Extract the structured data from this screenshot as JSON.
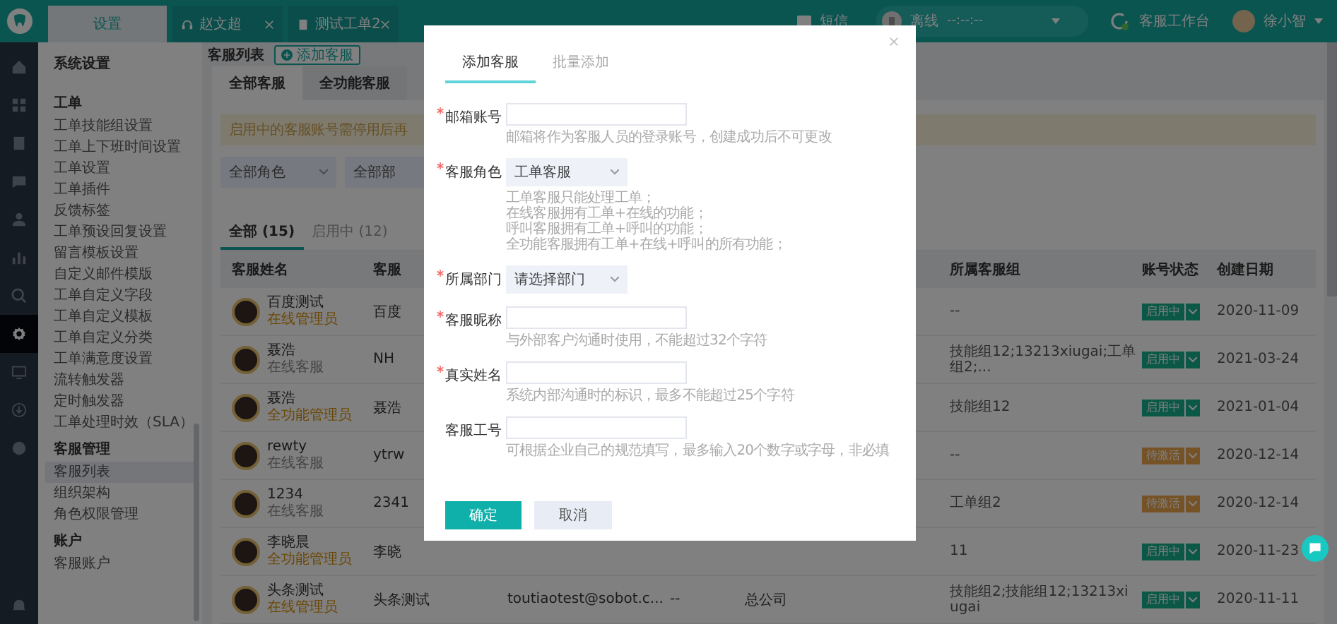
{
  "topbar": {
    "tabs": [
      {
        "label": "设置",
        "selected": true
      },
      {
        "label": "赵文超",
        "selected": false
      },
      {
        "label": "测试工单2",
        "selected": false
      }
    ],
    "sms": "短信",
    "presence": {
      "label": "离线",
      "time": "--:--:--"
    },
    "workbench": "客服工作台",
    "user": "徐小智"
  },
  "rail": [
    {
      "selected": false
    },
    {
      "selected": false
    },
    {
      "selected": false
    },
    {
      "selected": false
    },
    {
      "selected": false
    },
    {
      "selected": false
    },
    {
      "selected": false
    },
    {
      "selected": true
    },
    {
      "selected": false
    },
    {
      "selected": false
    },
    {
      "selected": false
    }
  ],
  "sidebar": {
    "title": "系统设置",
    "groups": [
      {
        "title": "工单",
        "items": [
          {
            "label": "工单技能组设置",
            "selected": false
          },
          {
            "label": "工单上下班时间设置",
            "selected": false
          },
          {
            "label": "工单设置",
            "selected": false
          },
          {
            "label": "工单插件",
            "selected": false
          },
          {
            "label": "反馈标签",
            "selected": false
          },
          {
            "label": "工单预设回复设置",
            "selected": false
          },
          {
            "label": "留言模板设置",
            "selected": false
          },
          {
            "label": "自定义邮件模版",
            "selected": false
          },
          {
            "label": "工单自定义字段",
            "selected": false
          },
          {
            "label": "工单自定义模板",
            "selected": false
          },
          {
            "label": "工单自定义分类",
            "selected": false
          },
          {
            "label": "工单满意度设置",
            "selected": false
          },
          {
            "label": "流转触发器",
            "selected": false
          },
          {
            "label": "定时触发器",
            "selected": false
          },
          {
            "label": "工单处理时效（SLA）",
            "selected": false
          }
        ]
      },
      {
        "title": "客服管理",
        "items": [
          {
            "label": "客服列表",
            "selected": true
          },
          {
            "label": "组织架构",
            "selected": false
          },
          {
            "label": "角色权限管理",
            "selected": false
          }
        ]
      },
      {
        "title": "账户",
        "items": [
          {
            "label": "客服账户",
            "selected": false
          }
        ]
      }
    ]
  },
  "main": {
    "title": "客服列表",
    "add_button": "添加客服",
    "tabs": [
      {
        "label": "全部客服",
        "selected": true
      },
      {
        "label": "全功能客服",
        "selected": false
      }
    ],
    "notice": "启用中的客服账号需停用后再",
    "filters": [
      "全部角色",
      "全部部"
    ],
    "status_tabs": [
      {
        "label": "全部 (15)",
        "selected": true
      },
      {
        "label": "启用中 (12)",
        "selected": false
      }
    ],
    "columns": [
      "客服姓名",
      "客服",
      "所属客服组",
      "账号状态",
      "创建日期"
    ],
    "rows": [
      {
        "name": "百度测试",
        "role": {
          "label": "在线管理员",
          "color": "#6c4806"
        },
        "nickname": "百度",
        "group": "--",
        "status": {
          "label": "启用中",
          "kind": "active"
        },
        "date": "2020-11-09"
      },
      {
        "name": "聂浩",
        "role": {
          "label": "在线客服",
          "color": "#444444"
        },
        "nickname": "NH",
        "group": "技能组12;13213xiugai;工单组2;...",
        "status": {
          "label": "启用中",
          "kind": "active"
        },
        "date": "2021-03-24"
      },
      {
        "name": "聂浩",
        "role": {
          "label": "全功能管理员",
          "color": "#6c4806"
        },
        "nickname": "聂浩",
        "group": "技能组12",
        "status": {
          "label": "启用中",
          "kind": "active"
        },
        "date": "2021-01-04"
      },
      {
        "name": "rewty",
        "role": {
          "label": "在线客服",
          "color": "#444444"
        },
        "nickname": "ytrw",
        "group": "--",
        "status": {
          "label": "待激活",
          "kind": "pending"
        },
        "date": "2020-12-14"
      },
      {
        "name": "1234",
        "role": {
          "label": "在线客服",
          "color": "#444444"
        },
        "nickname": "2341",
        "group": "工单组2",
        "status": {
          "label": "待激活",
          "kind": "pending"
        },
        "date": "2020-12-14"
      },
      {
        "name": "李晓晨",
        "role": {
          "label": "全功能管理员",
          "color": "#6c4806"
        },
        "nickname": "李晓",
        "group": "11",
        "status": {
          "label": "启用中",
          "kind": "active"
        },
        "date": "2020-11-23"
      },
      {
        "name": "头条测试",
        "role": {
          "label": "在线管理员",
          "color": "#6c4806"
        },
        "nickname": "头条测试",
        "email": "toutiaotest@sobot.c...",
        "column_4": "--",
        "column_5": "总公司",
        "group": "技能组2;技能组12;13213xiugai",
        "status": {
          "label": "启用中",
          "kind": "active"
        },
        "date": "2020-11-11"
      }
    ]
  },
  "dialog": {
    "tabs": [
      {
        "label": "添加客服",
        "selected": true
      },
      {
        "label": "批量添加",
        "selected": false
      }
    ],
    "fields": [
      {
        "label": "邮箱账号",
        "required": true,
        "kind": "input",
        "hints": [
          "邮箱将作为客服人员的登录账号，创建成功后不可更改"
        ]
      },
      {
        "label": "客服角色",
        "required": true,
        "kind": "select",
        "value": "工单客服",
        "hints": [
          "工单客服只能处理工单；",
          "在线客服拥有工单+在线的功能；",
          "呼叫客服拥有工单+呼叫的功能；",
          "全功能客服拥有工单+在线+呼叫的所有功能；"
        ]
      },
      {
        "label": "所属部门",
        "required": true,
        "kind": "select",
        "value": "请选择部门"
      },
      {
        "label": "客服昵称",
        "required": true,
        "kind": "input",
        "hints": [
          "与外部客户沟通时使用，不能超过32个字符"
        ]
      },
      {
        "label": "真实姓名",
        "required": true,
        "kind": "input",
        "hints": [
          "系统内部沟通时的标识，最多不能超过25个字符"
        ]
      },
      {
        "label": "客服工号",
        "required": false,
        "kind": "input",
        "hints": [
          "可根据企业自己的规范填写，最多输入20个数字或字母，非必填"
        ]
      }
    ],
    "confirm": "确定",
    "cancel": "取消"
  }
}
